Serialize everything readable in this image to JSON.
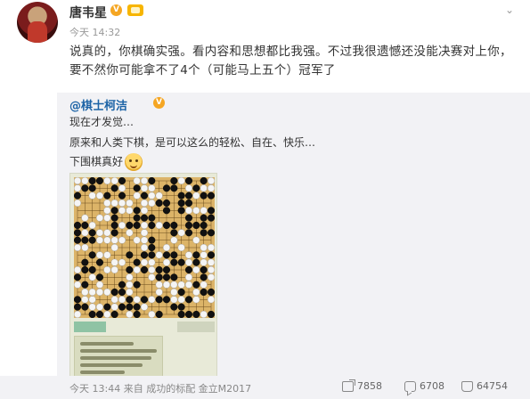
{
  "post": {
    "username": "唐韦星",
    "verified_badge": "V",
    "time": "今天 14:32",
    "text": "说真的，你棋确实强。看内容和思想都比我强。不过我很遗憾还没能决赛对上你，要不然你可能拿不了4个（可能马上五个）冠军了"
  },
  "repost": {
    "username": "@棋士柯洁",
    "verified_badge": "V",
    "lines": [
      "现在才发觉…",
      "原来和人类下棋，是可以这么的轻松、自在、快乐…",
      "下围棋真好"
    ]
  },
  "footer": {
    "meta": "今天 13:44 来自 成功的标配 金立M2017",
    "shares": "7858",
    "comments": "6708",
    "likes": "64754"
  },
  "icons": {
    "share": "share-icon",
    "comment": "comment-icon",
    "like": "like-icon",
    "more": "chevron-down-icon"
  },
  "colors": {
    "repost_bg": "#f2f2f5",
    "link": "#1c63a6",
    "badge": "#f5a623",
    "board": "#dcb468"
  }
}
